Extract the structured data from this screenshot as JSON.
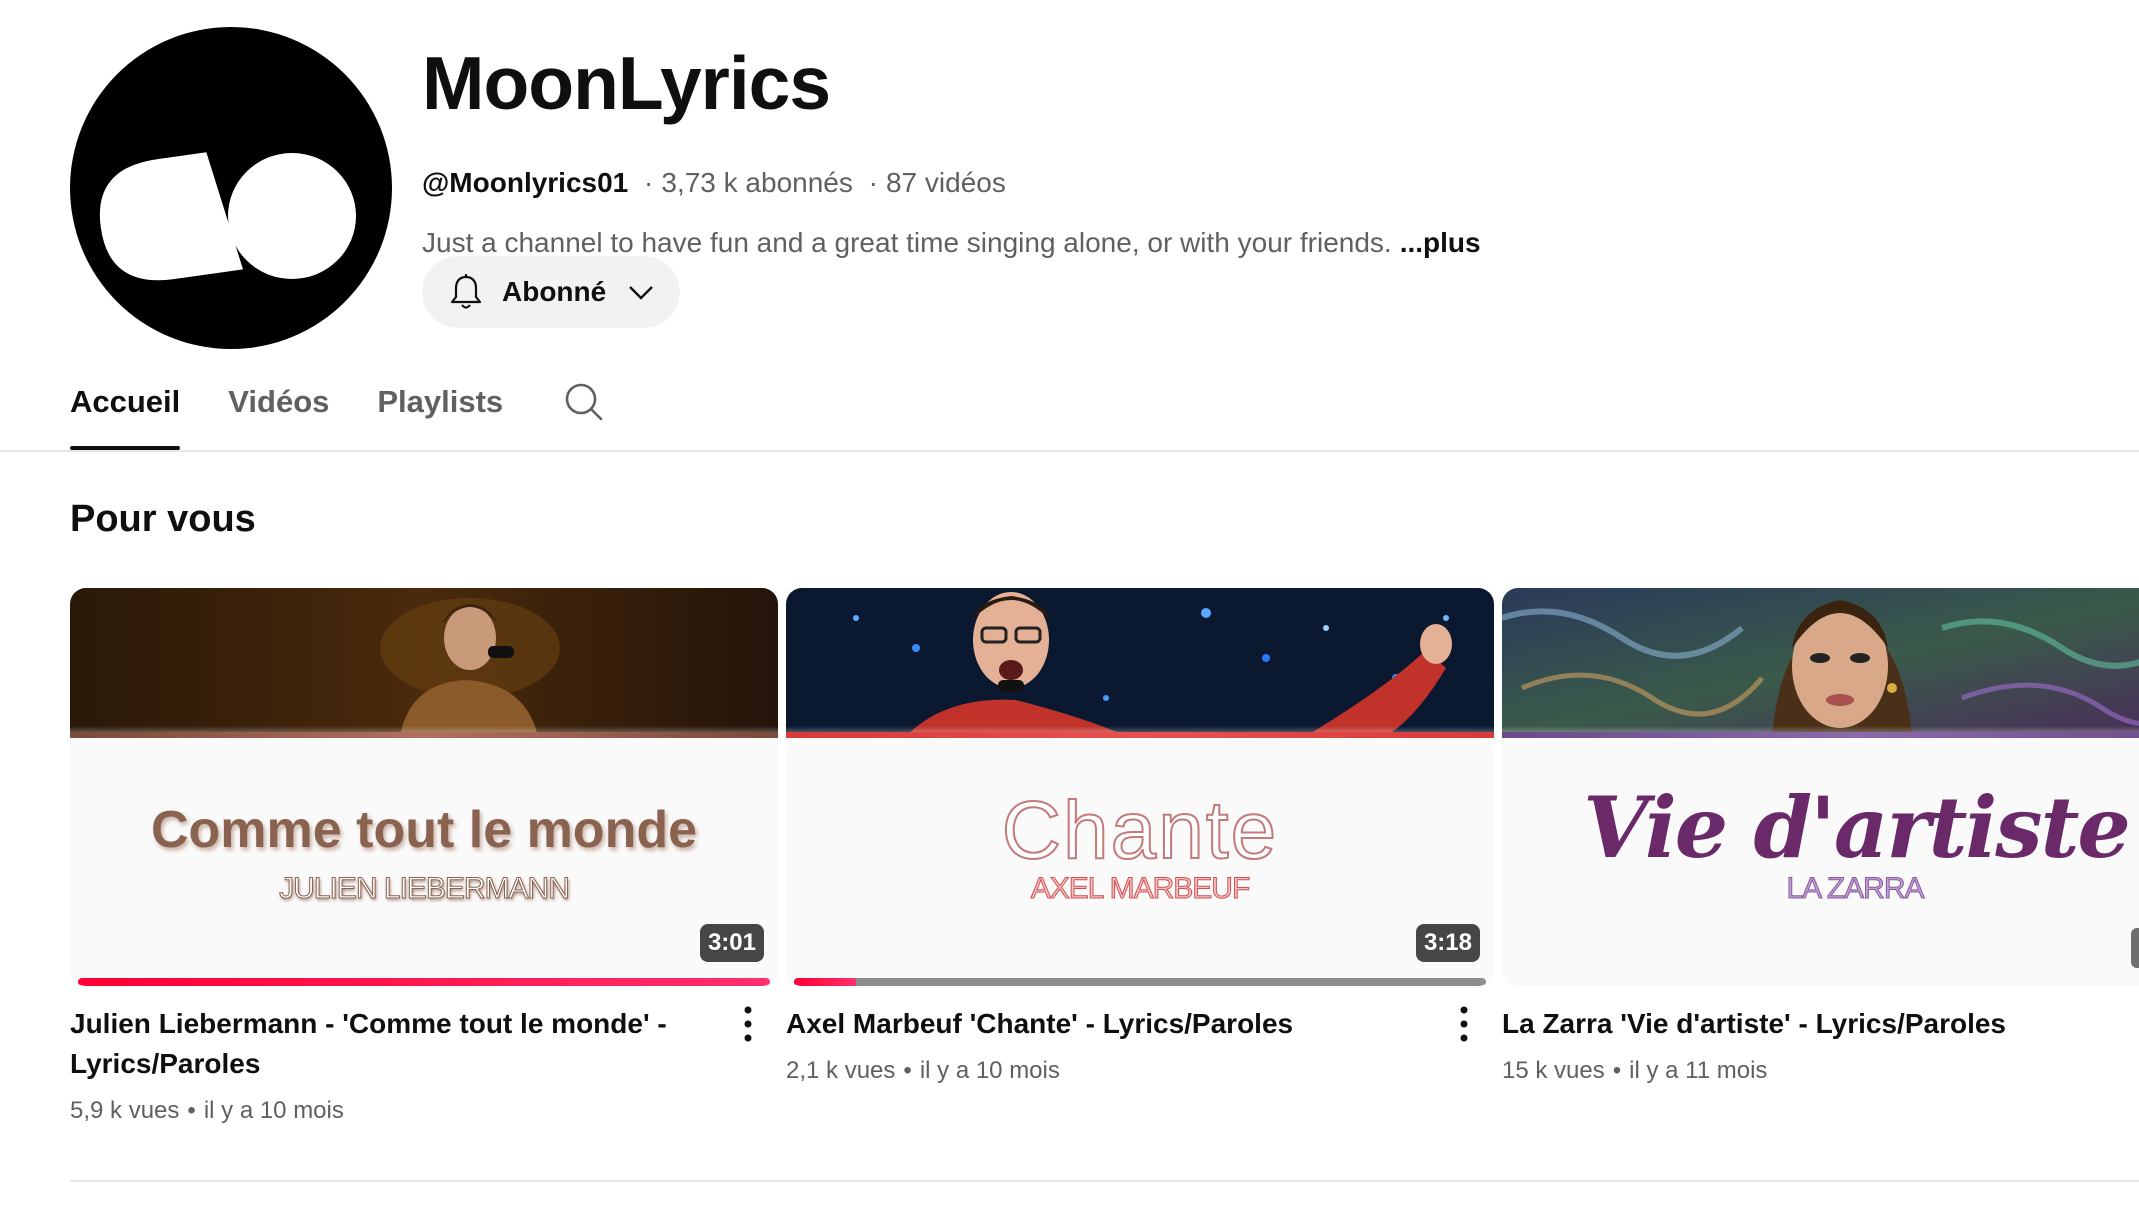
{
  "channel": {
    "name": "MoonLyrics",
    "handle": "@Moonlyrics01",
    "subscribers": "3,73 k abonnés",
    "videos": "87 vidéos",
    "separator": "·",
    "description": "Just a channel to have fun and a great time singing alone, or with your friends.",
    "more": "...plus",
    "subscribe_label": "Abonné"
  },
  "tabs": [
    {
      "label": "Accueil",
      "active": true
    },
    {
      "label": "Vidéos",
      "active": false
    },
    {
      "label": "Playlists",
      "active": false
    }
  ],
  "section": {
    "title": "Pour vous"
  },
  "videos": [
    {
      "title": "Julien Liebermann - 'Comme tout le monde' - Lyrics/Paroles",
      "views": "5,9 k vues",
      "age": "il y a 10 mois",
      "duration": "3:01",
      "watched_fraction": 1.0,
      "thumb_song": "Comme tout le monde",
      "thumb_artist": "JULIEN LIEBERMANN"
    },
    {
      "title": "Axel Marbeuf 'Chante' - Lyrics/Paroles",
      "views": "2,1 k vues",
      "age": "il y a 10 mois",
      "duration": "3:18",
      "watched_fraction": 0.09,
      "thumb_song": "Chante",
      "thumb_artist": "AXEL MARBEUF"
    },
    {
      "title": "La Zarra 'Vie d'artiste' - Lyrics/Paroles",
      "views": "15 k vues",
      "age": "il y a 11 mois",
      "duration": "",
      "watched_fraction": null,
      "thumb_song": "Vie d'artiste",
      "thumb_artist": "LA ZARRA"
    }
  ],
  "colors": {
    "accent_red": "#ff0033",
    "text_primary": "#0f0f0f",
    "text_secondary": "#606060",
    "button_bg": "#f2f2f2"
  },
  "icons": {
    "bell": "bell-icon",
    "chevron": "chevron-down-icon",
    "search": "search-icon",
    "more": "more-vert-icon"
  }
}
